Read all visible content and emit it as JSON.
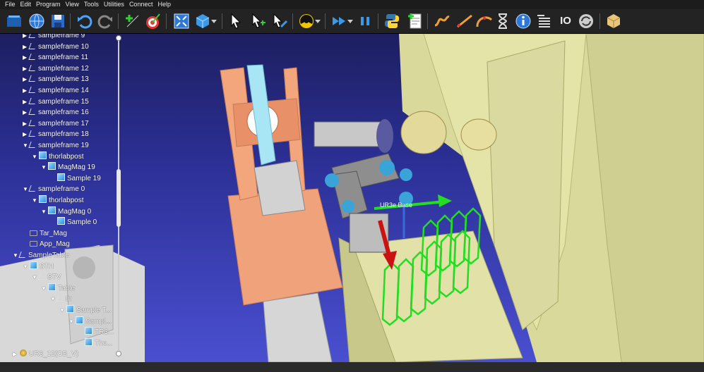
{
  "menu": [
    "File",
    "Edit",
    "Program",
    "View",
    "Tools",
    "Utilities",
    "Connect",
    "Help"
  ],
  "toolbar": {
    "icons": [
      "open-station",
      "web",
      "save",
      "undo",
      "redo",
      "add-target",
      "teach-target",
      "fit-all",
      "cube-view",
      "dropdown",
      "select-cursor",
      "select-target",
      "select-frame",
      "collision",
      "run-fast",
      "pause",
      "python",
      "add-program",
      "move-joint",
      "move-linear",
      "move-circular",
      "wait",
      "info",
      "program-instructions",
      "io",
      "loop",
      "package"
    ],
    "io_label": "IO"
  },
  "tree": {
    "items": [
      {
        "label": "sampleframe 9",
        "type": "frame",
        "indent": 0
      },
      {
        "label": "sampleframe 10",
        "type": "frame",
        "indent": 0
      },
      {
        "label": "sampleframe 11",
        "type": "frame",
        "indent": 0
      },
      {
        "label": "sampleframe 12",
        "type": "frame",
        "indent": 0
      },
      {
        "label": "sampleframe 13",
        "type": "frame",
        "indent": 0
      },
      {
        "label": "sampleframe 14",
        "type": "frame",
        "indent": 0
      },
      {
        "label": "sampleframe 15",
        "type": "frame",
        "indent": 0
      },
      {
        "label": "sampleframe 16",
        "type": "frame",
        "indent": 0
      },
      {
        "label": "sampleframe 17",
        "type": "frame",
        "indent": 0
      },
      {
        "label": "sampleframe 18",
        "type": "frame",
        "indent": 0
      },
      {
        "label": "sampleframe 19",
        "type": "frame",
        "indent": 0
      },
      {
        "label": "thorlabpost",
        "type": "cube",
        "indent": 1
      },
      {
        "label": "MagMag 19",
        "type": "cube",
        "indent": 2
      },
      {
        "label": "Sample 19",
        "type": "cube",
        "indent": 3
      },
      {
        "label": "sampleframe 0",
        "type": "frame",
        "indent": 0
      },
      {
        "label": "thorlabpost",
        "type": "cube",
        "indent": 1
      },
      {
        "label": "MagMag 0",
        "type": "cube",
        "indent": 2
      },
      {
        "label": "Sample 0",
        "type": "cube",
        "indent": 3
      },
      {
        "label": "Tar_Mag",
        "type": "tool",
        "indent": 0
      },
      {
        "label": "App_Mag",
        "type": "tool",
        "indent": 0
      },
      {
        "label": "SampleTable",
        "type": "frame",
        "indent": -1
      },
      {
        "label": "STH",
        "type": "cube",
        "indent": 0
      },
      {
        "label": "STV",
        "type": "frame",
        "indent": 1
      },
      {
        "label": "Table",
        "type": "cube",
        "indent": 2
      },
      {
        "label": "th",
        "type": "frame",
        "indent": 3
      },
      {
        "label": "Sample T...",
        "type": "cube",
        "indent": 4
      },
      {
        "label": "Sampl...",
        "type": "cube",
        "indent": 5
      },
      {
        "label": "TR3...",
        "type": "cube",
        "indent": 6
      },
      {
        "label": "Tho...",
        "type": "cube",
        "indent": 6
      },
      {
        "label": "UR3_12(OB_V)",
        "type": "robot",
        "indent": -1
      }
    ]
  },
  "scene": {
    "overlay_label": "UR3e Base",
    "colors": {
      "sky_top": "#1d1f60",
      "sky_bottom": "#4a4fd0",
      "wall": "#dedea3",
      "orange": "#f0a27a",
      "cyan": "#a8e6f5",
      "robot_gray": "#8a8a8a",
      "robot_blue": "#3aa3d8",
      "green": "#22dd22",
      "red": "#cc1111"
    }
  }
}
